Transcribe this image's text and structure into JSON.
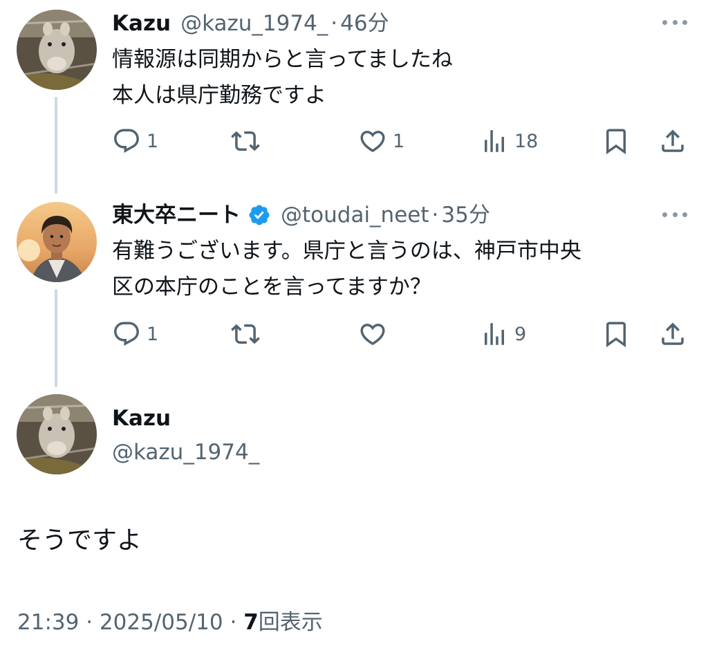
{
  "tweets": [
    {
      "display_name": "Kazu",
      "handle": "@kazu_1974_",
      "separator": "·",
      "time": "46分",
      "text": "情報源は同期からと言ってましたね\n本人は県庁勤務ですよ",
      "reply_count": "1",
      "retweet_count": "",
      "like_count": "1",
      "view_count": "18"
    },
    {
      "display_name": "東大卒ニート",
      "handle": "@toudai_neet",
      "separator": "·",
      "time": "35分",
      "text": "有難うございます。県庁と言うのは、神戸市中央\n区の本庁のことを言ってますか？",
      "reply_count": "1",
      "retweet_count": "",
      "like_count": "",
      "view_count": "9"
    }
  ],
  "main_tweet": {
    "display_name": "Kazu",
    "handle": "@kazu_1974_",
    "text": "そうですよ",
    "time": "21:39",
    "sep1": "·",
    "date": "2025/05/10",
    "sep2": "·",
    "views": "7",
    "views_label": "回表示"
  },
  "icons": {
    "reply": "reply-icon",
    "retweet": "retweet-icon",
    "like": "heart-icon",
    "views": "views-bar-chart-icon",
    "bookmark": "bookmark-icon",
    "share": "share-icon",
    "more": "more-dots-icon",
    "verified": "verified-badge-icon"
  },
  "colors": {
    "text": "#0f1419",
    "secondary": "#536471",
    "verified": "#1d9bf0",
    "thread_line": "#cfd9de"
  }
}
